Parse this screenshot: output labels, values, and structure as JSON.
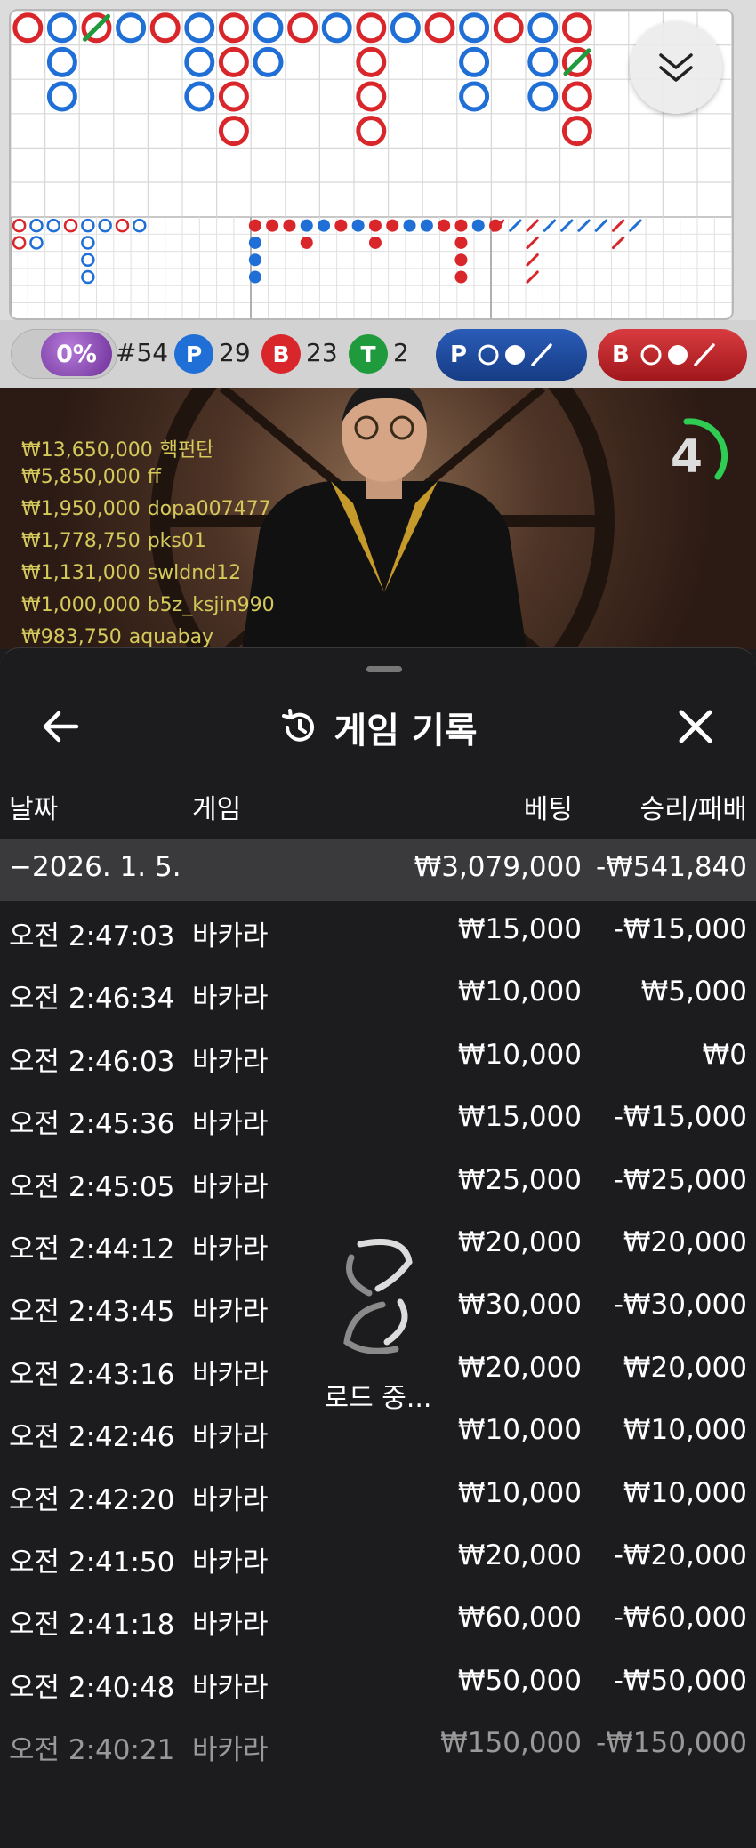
{
  "roadmap": {
    "big_road": [
      {
        "col": 0,
        "row": 0,
        "c": "B"
      },
      {
        "col": 1,
        "row": 0,
        "c": "P"
      },
      {
        "col": 1,
        "row": 1,
        "c": "P"
      },
      {
        "col": 1,
        "row": 2,
        "c": "P"
      },
      {
        "col": 2,
        "row": 0,
        "c": "B"
      },
      {
        "col": 3,
        "row": 0,
        "c": "P"
      },
      {
        "col": 4,
        "row": 0,
        "c": "B"
      },
      {
        "col": 5,
        "row": 0,
        "c": "P"
      },
      {
        "col": 5,
        "row": 1,
        "c": "P"
      },
      {
        "col": 5,
        "row": 2,
        "c": "P"
      },
      {
        "col": 6,
        "row": 0,
        "c": "B"
      },
      {
        "col": 6,
        "row": 1,
        "c": "B"
      },
      {
        "col": 6,
        "row": 2,
        "c": "B"
      },
      {
        "col": 6,
        "row": 3,
        "c": "B"
      },
      {
        "col": 7,
        "row": 0,
        "c": "P"
      },
      {
        "col": 7,
        "row": 1,
        "c": "P"
      },
      {
        "col": 8,
        "row": 0,
        "c": "B"
      },
      {
        "col": 9,
        "row": 0,
        "c": "P"
      },
      {
        "col": 10,
        "row": 0,
        "c": "B"
      },
      {
        "col": 10,
        "row": 1,
        "c": "B"
      },
      {
        "col": 10,
        "row": 2,
        "c": "B"
      },
      {
        "col": 10,
        "row": 3,
        "c": "B"
      },
      {
        "col": 11,
        "row": 0,
        "c": "P"
      },
      {
        "col": 12,
        "row": 0,
        "c": "B"
      },
      {
        "col": 13,
        "row": 0,
        "c": "P"
      },
      {
        "col": 13,
        "row": 1,
        "c": "P"
      },
      {
        "col": 13,
        "row": 2,
        "c": "P"
      },
      {
        "col": 14,
        "row": 0,
        "c": "B"
      },
      {
        "col": 15,
        "row": 0,
        "c": "P"
      },
      {
        "col": 15,
        "row": 1,
        "c": "P"
      },
      {
        "col": 15,
        "row": 2,
        "c": "P"
      },
      {
        "col": 16,
        "row": 0,
        "c": "B"
      },
      {
        "col": 16,
        "row": 1,
        "c": "B"
      },
      {
        "col": 16,
        "row": 2,
        "c": "B"
      },
      {
        "col": 16,
        "row": 3,
        "c": "B"
      }
    ],
    "ties": [
      {
        "col": 2,
        "row": 0
      },
      {
        "col": 16,
        "row": 1
      }
    ]
  },
  "stats": {
    "percent": "0%",
    "round": "#54",
    "player_letter": "P",
    "player_count": "29",
    "banker_letter": "B",
    "banker_count": "23",
    "tie_letter": "T",
    "tie_count": "2",
    "predict_player": "P",
    "predict_banker": "B"
  },
  "video": {
    "countdown": "4",
    "bets": [
      {
        "amount": "₩13,650,000",
        "name": "핵펀탄"
      },
      {
        "amount": "₩5,850,000",
        "name": "ff"
      },
      {
        "amount": "₩1,950,000",
        "name": "dopa007477"
      },
      {
        "amount": "₩1,778,750",
        "name": "pks01"
      },
      {
        "amount": "₩1,131,000",
        "name": "swldnd12"
      },
      {
        "amount": "₩1,000,000",
        "name": "b5z_ksjin990"
      },
      {
        "amount": "₩983,750",
        "name": "aquabay"
      }
    ]
  },
  "history": {
    "title": "게임 기록",
    "columns": {
      "date": "날짜",
      "game": "게임",
      "bet": "베팅",
      "result": "승리/패배"
    },
    "day": {
      "date": "−2026. 1. 5.",
      "bet": "₩3,079,000",
      "result": "-₩541,840"
    },
    "rows": [
      {
        "time": "오전 2:47:03",
        "game": "바카라",
        "bet": "₩15,000",
        "result": "-₩15,000"
      },
      {
        "time": "오전 2:46:34",
        "game": "바카라",
        "bet": "₩10,000",
        "result": "₩5,000"
      },
      {
        "time": "오전 2:46:03",
        "game": "바카라",
        "bet": "₩10,000",
        "result": "₩0"
      },
      {
        "time": "오전 2:45:36",
        "game": "바카라",
        "bet": "₩15,000",
        "result": "-₩15,000"
      },
      {
        "time": "오전 2:45:05",
        "game": "바카라",
        "bet": "₩25,000",
        "result": "-₩25,000"
      },
      {
        "time": "오전 2:44:12",
        "game": "바카라",
        "bet": "₩20,000",
        "result": "₩20,000"
      },
      {
        "time": "오전 2:43:45",
        "game": "바카라",
        "bet": "₩30,000",
        "result": "-₩30,000"
      },
      {
        "time": "오전 2:43:16",
        "game": "바카라",
        "bet": "₩20,000",
        "result": "₩20,000"
      },
      {
        "time": "오전 2:42:46",
        "game": "바카라",
        "bet": "₩10,000",
        "result": "₩10,000"
      },
      {
        "time": "오전 2:42:20",
        "game": "바카라",
        "bet": "₩10,000",
        "result": "₩10,000"
      },
      {
        "time": "오전 2:41:50",
        "game": "바카라",
        "bet": "₩20,000",
        "result": "-₩20,000"
      },
      {
        "time": "오전 2:41:18",
        "game": "바카라",
        "bet": "₩60,000",
        "result": "-₩60,000"
      },
      {
        "time": "오전 2:40:48",
        "game": "바카라",
        "bet": "₩50,000",
        "result": "-₩50,000"
      },
      {
        "time": "오전 2:40:21",
        "game": "바카라",
        "bet": "₩150,000",
        "result": "-₩150,000"
      }
    ],
    "loading": "로드 중..."
  },
  "colors": {
    "player": "#1f6fd6",
    "banker": "#d9262b",
    "tie": "#1f9a3c"
  }
}
